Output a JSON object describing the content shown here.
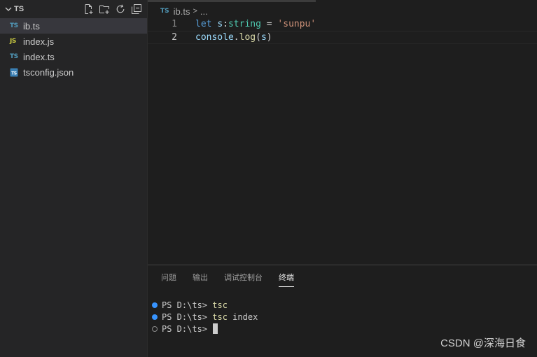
{
  "explorer": {
    "folder_name": "TS",
    "actions": [
      "new-file",
      "new-folder",
      "refresh",
      "collapse-all"
    ],
    "files": [
      {
        "icon": "TS",
        "type": "ts",
        "name": "ib.ts",
        "active": true
      },
      {
        "icon": "JS",
        "type": "js",
        "name": "index.js",
        "active": false
      },
      {
        "icon": "TS",
        "type": "ts",
        "name": "index.ts",
        "active": false
      },
      {
        "icon": "TS",
        "type": "json",
        "name": "tsconfig.json",
        "active": false
      }
    ]
  },
  "editor": {
    "breadcrumb": {
      "icon": "TS",
      "file": "ib.ts",
      "separator": ">",
      "rest": "..."
    },
    "lines": [
      {
        "number": "1",
        "tokens": [
          "let",
          " ",
          "s",
          ":",
          "string",
          " = ",
          "'sunpu'"
        ]
      },
      {
        "number": "2",
        "tokens": [
          "console",
          ".",
          "log",
          "(",
          "s",
          ")"
        ]
      }
    ]
  },
  "panel": {
    "tabs": [
      "问题",
      "输出",
      "调试控制台",
      "终端"
    ],
    "active_tab": "终端",
    "terminal": [
      {
        "status": "success",
        "prompt": "PS D:\\ts>",
        "command": "tsc",
        "args": ""
      },
      {
        "status": "success",
        "prompt": "PS D:\\ts>",
        "command": "tsc",
        "args": " index"
      },
      {
        "status": "idle",
        "prompt": "PS D:\\ts>",
        "command": "",
        "args": ""
      }
    ]
  },
  "watermark": "CSDN @深海日食",
  "colors": {
    "ts_icon": "#519aba",
    "js_icon": "#cbcb41",
    "keyword": "#569cd6",
    "variable": "#9cdcfe",
    "type": "#4ec9b0",
    "string": "#ce9178",
    "function": "#dcdcaa",
    "status_dot": "#3794ff"
  }
}
